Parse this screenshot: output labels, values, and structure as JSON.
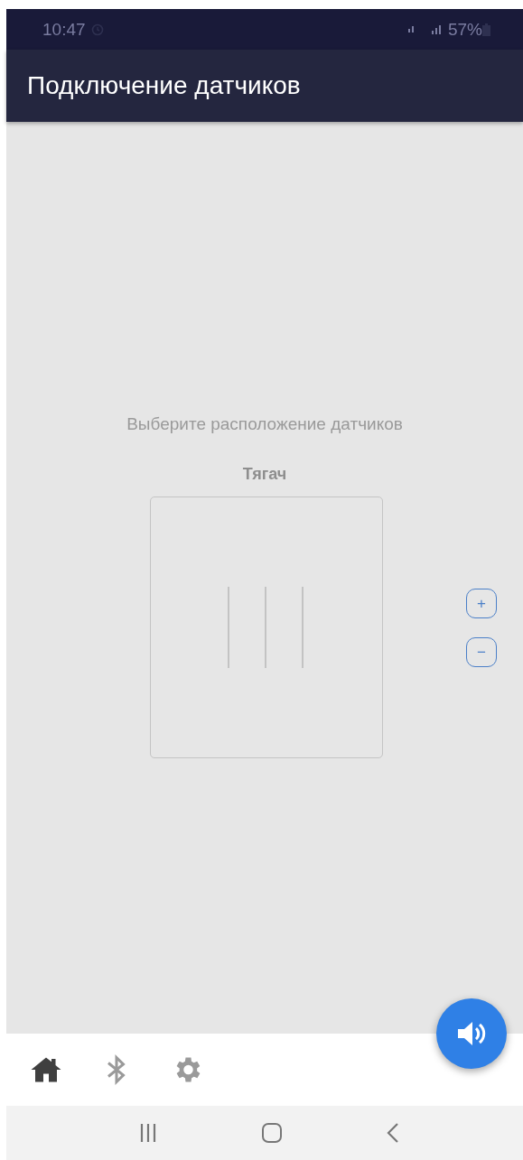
{
  "status_bar": {
    "time": "10:47",
    "battery": "57%"
  },
  "app_bar": {
    "title": "Подключение датчиков"
  },
  "prompt": "Выберите расположение датчиков",
  "vehicle": {
    "label": "Тягач"
  },
  "zoom_buttons": [
    {
      "label": "+"
    },
    {
      "label": "−"
    }
  ],
  "bottom_nav": [
    {
      "kind": "home",
      "selected": true
    },
    {
      "kind": "bluetooth",
      "selected": false
    },
    {
      "kind": "settings",
      "selected": false
    }
  ]
}
